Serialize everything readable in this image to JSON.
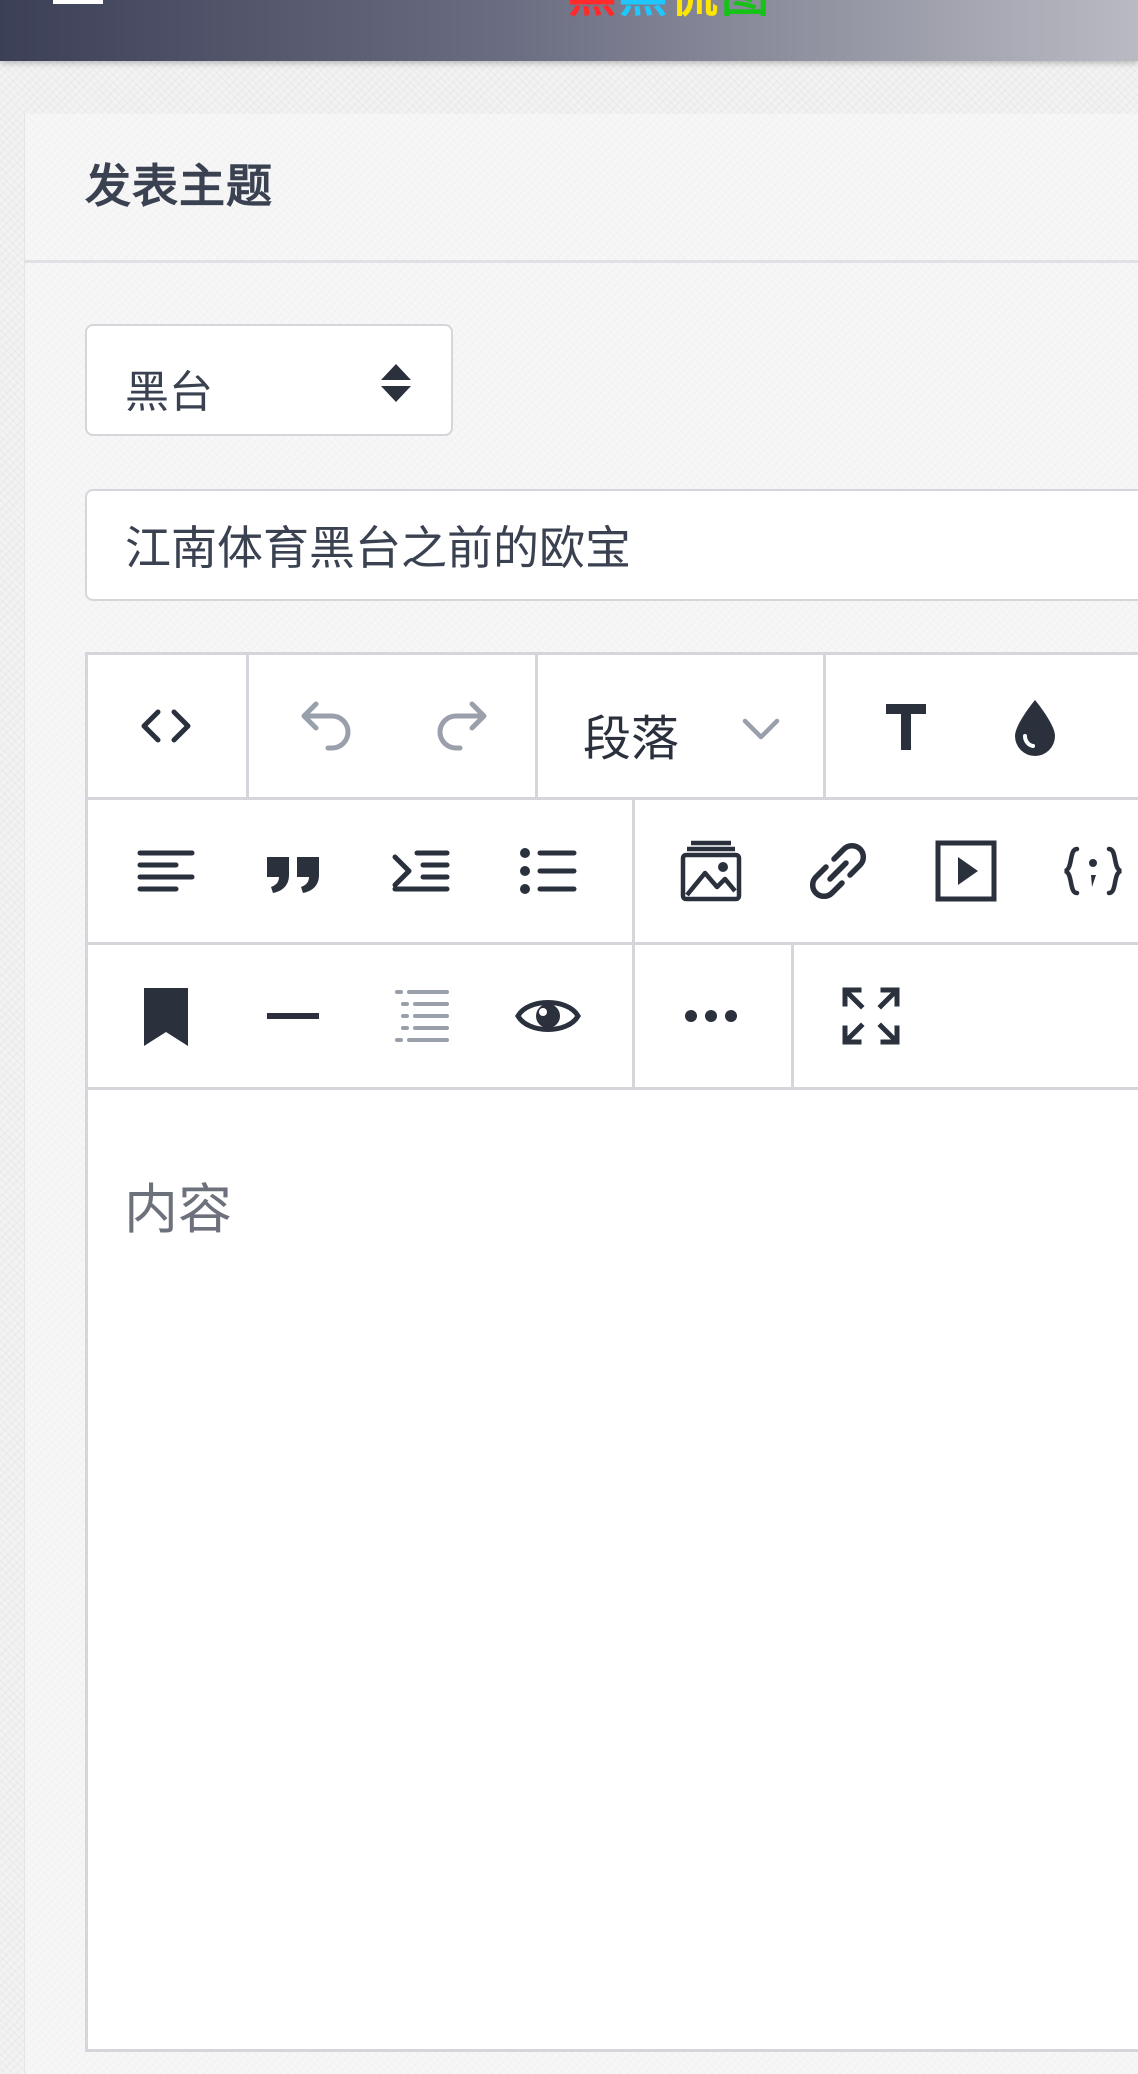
{
  "header": {
    "logo_chars": [
      "黑",
      "黑",
      "侃",
      "图"
    ],
    "logo_colors": [
      "#ff2a2a",
      "#1ec8ff",
      "#ffe600",
      "#16c216"
    ]
  },
  "page": {
    "title": "发表主题"
  },
  "form": {
    "category_select": {
      "selected": "黑台",
      "icon": "sort-caret-icon"
    },
    "title_input": {
      "value": "江南体育黑台之前的欧宝"
    },
    "editor": {
      "toolbar": {
        "row1": [
          "code-view-icon",
          "undo-icon",
          "redo-icon",
          "paragraph-format-dropdown",
          "text-style-icon",
          "text-color-icon"
        ],
        "paragraph_label": "段落",
        "row2": [
          "align-left-icon",
          "quote-icon",
          "indent-icon",
          "unordered-list-icon",
          "insert-image-icon",
          "insert-link-icon",
          "insert-video-icon",
          "code-block-icon"
        ],
        "row3": [
          "bookmark-icon",
          "horizontal-rule-icon",
          "ordered-list-icon",
          "preview-eye-icon",
          "more-icon",
          "fullscreen-icon"
        ]
      },
      "placeholder": "内容"
    }
  },
  "colors": {
    "header_gradient_start": "#3c4057",
    "header_gradient_end": "#b9bac2",
    "icon_dark": "#2a313d",
    "icon_muted": "#9aa0ab",
    "border": "#d4d6db"
  }
}
